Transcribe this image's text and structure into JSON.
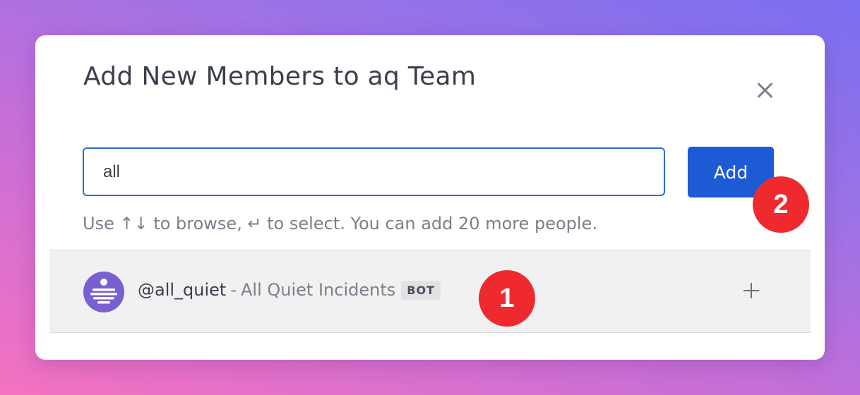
{
  "modal": {
    "title": "Add New Members to aq Team",
    "close_icon": "close-icon"
  },
  "search": {
    "value": "all",
    "placeholder": ""
  },
  "add_button": {
    "label": "Add",
    "color": "#1c5ad6"
  },
  "hint": {
    "text": "Use ↑↓ to browse, ↵ to select. You can add 20 more people."
  },
  "results": [
    {
      "handle": "@all_quiet",
      "separator": "-",
      "full_name": "All Quiet Incidents",
      "badge": "BOT",
      "avatar_icon": "all-quiet-logo-icon",
      "action_icon": "plus-icon"
    }
  ],
  "annotations": {
    "marker_1": "1",
    "marker_2": "2",
    "color": "#ef2a2e"
  }
}
